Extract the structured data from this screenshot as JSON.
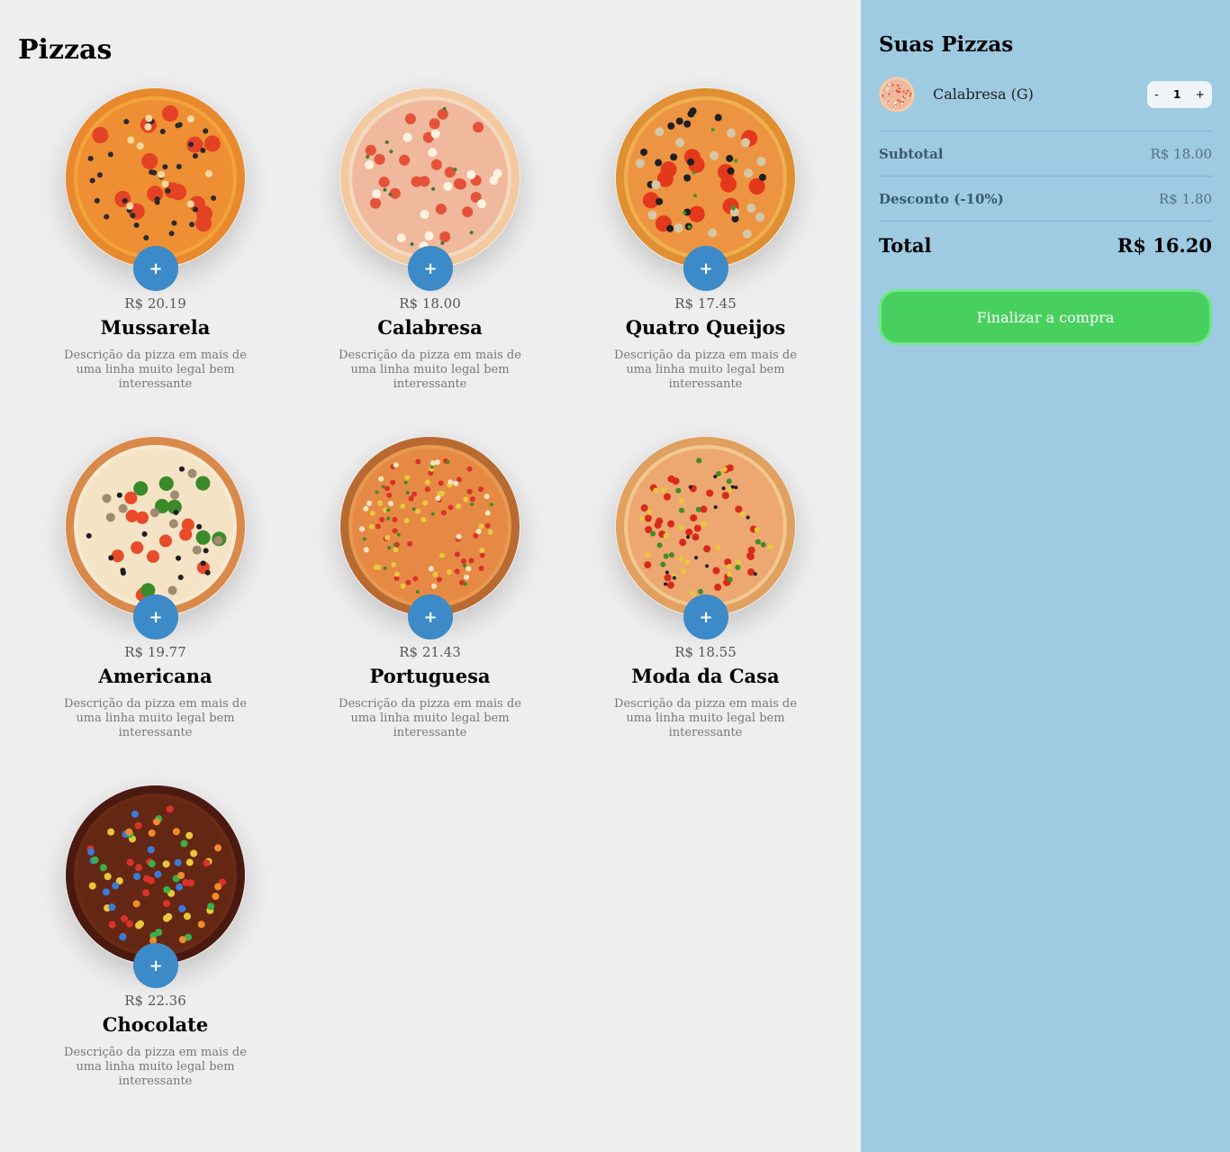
{
  "main": {
    "title": "Pizzas",
    "add_label": "+",
    "pizzas": [
      {
        "name": "Mussarela",
        "price": "R$ 20.19",
        "desc": "Descrição da pizza em mais de uma linha muito legal bem interessante",
        "style": "mussarela"
      },
      {
        "name": "Calabresa",
        "price": "R$ 18.00",
        "desc": "Descrição da pizza em mais de uma linha muito legal bem interessante",
        "style": "calabresa"
      },
      {
        "name": "Quatro Queijos",
        "price": "R$ 17.45",
        "desc": "Descrição da pizza em mais de uma linha muito legal bem interessante",
        "style": "quatro"
      },
      {
        "name": "Americana",
        "price": "R$ 19.77",
        "desc": "Descrição da pizza em mais de uma linha muito legal bem interessante",
        "style": "americana"
      },
      {
        "name": "Portuguesa",
        "price": "R$ 21.43",
        "desc": "Descrição da pizza em mais de uma linha muito legal bem interessante",
        "style": "portuguesa"
      },
      {
        "name": "Moda da Casa",
        "price": "R$ 18.55",
        "desc": "Descrição da pizza em mais de uma linha muito legal bem interessante",
        "style": "casa"
      },
      {
        "name": "Chocolate",
        "price": "R$ 22.36",
        "desc": "Descrição da pizza em mais de uma linha muito legal bem interessante",
        "style": "chocolate"
      }
    ]
  },
  "cart": {
    "title": "Suas Pizzas",
    "items": [
      {
        "name": "Calabresa (G)",
        "qty": "1",
        "minus": "-",
        "plus": "+"
      }
    ],
    "subtotal_label": "Subtotal",
    "subtotal_value": "R$ 18.00",
    "discount_label": "Desconto (-10%)",
    "discount_value": "R$ 1.80",
    "total_label": "Total",
    "total_value": "R$ 16.20",
    "checkout_label": "Finalizar a compra"
  },
  "colors": {
    "main_bg": "#eeeeee",
    "sidebar_bg": "#9ecae2",
    "add_button": "#3c8ac7",
    "checkout_button": "#48d05f"
  }
}
